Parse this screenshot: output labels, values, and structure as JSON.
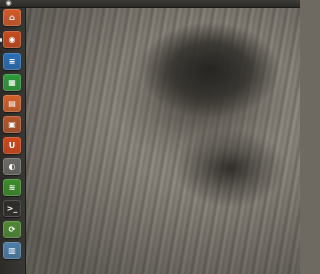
{
  "top_panel": {
    "dash_glyph": "◉"
  },
  "launcher": {
    "items": [
      {
        "name": "ubuntu-home-icon",
        "glyph": "⌂",
        "bg": "#d45a2a",
        "active": false
      },
      {
        "name": "firefox-icon",
        "glyph": "◉",
        "bg": "#c64b1e",
        "active": true
      },
      {
        "name": "libreoffice-writer-icon",
        "glyph": "≡",
        "bg": "#2a6fb7",
        "active": false
      },
      {
        "name": "libreoffice-calc-icon",
        "glyph": "▦",
        "bg": "#2f9a3c",
        "active": false
      },
      {
        "name": "libreoffice-impress-icon",
        "glyph": "▤",
        "bg": "#d2612a",
        "active": false
      },
      {
        "name": "software-center-icon",
        "glyph": "▣",
        "bg": "#b3562c",
        "active": false
      },
      {
        "name": "ubuntu-one-icon",
        "glyph": "U",
        "bg": "#d3471b",
        "active": false
      },
      {
        "name": "system-settings-icon",
        "glyph": "◐",
        "bg": "#6c6a66",
        "active": false
      },
      {
        "name": "spotify-icon",
        "glyph": "≋",
        "bg": "#3c8d2b",
        "active": false
      },
      {
        "name": "terminal-icon",
        "glyph": ">_",
        "bg": "#2e2d2a",
        "active": false
      },
      {
        "name": "update-manager-icon",
        "glyph": "⟳",
        "bg": "#4f8a36",
        "active": false
      },
      {
        "name": "workspace-switcher-icon",
        "glyph": "▥",
        "bg": "#4d7ea8",
        "active": false
      }
    ]
  }
}
